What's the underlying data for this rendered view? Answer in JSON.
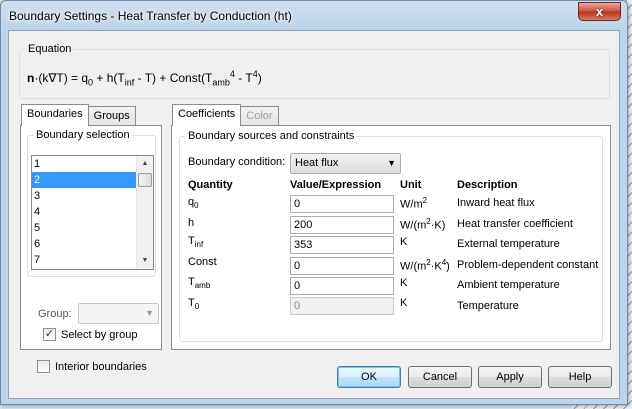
{
  "window": {
    "title": "Boundary Settings - Heat Transfer by Conduction (ht)",
    "close_glyph": "x"
  },
  "equation": {
    "label": "Equation",
    "n": "n",
    "p1": "·(k∇T) = q",
    "s1": "0",
    "p2": " + h(T",
    "s2": "inf",
    "p3": " - T) + Const(T",
    "s3": "amb",
    "s4": "4",
    "p4": " - T",
    "s5": "4",
    "p5": ")"
  },
  "left_tabs": [
    {
      "label": "Boundaries"
    },
    {
      "label": "Groups"
    }
  ],
  "boundary_selection": {
    "label": "Boundary selection",
    "items": [
      "1",
      "2",
      "3",
      "4",
      "5",
      "6",
      "7"
    ],
    "selected": "2"
  },
  "group": {
    "label": "Group:",
    "value": ""
  },
  "select_by_group": {
    "label": "Select by group",
    "checked": true,
    "mark": "✓"
  },
  "interior_boundaries": {
    "label": "Interior boundaries",
    "checked": false
  },
  "right_tabs": [
    {
      "label": "Coefficients"
    },
    {
      "label": "Color"
    }
  ],
  "sources": {
    "label": "Boundary sources and constraints",
    "condition_label": "Boundary condition:",
    "condition_value": "Heat flux",
    "headers": {
      "quantity": "Quantity",
      "value": "Value/Expression",
      "unit": "Unit",
      "description": "Description"
    },
    "rows": [
      {
        "q_main": "q",
        "q_sub": "0",
        "value": "0",
        "u_main": "W/m",
        "u_sup": "2",
        "u_end": "",
        "description": "Inward heat flux"
      },
      {
        "q_main": "h",
        "q_sub": "",
        "value": "200",
        "u_main": "W/(m",
        "u_sup": "2",
        "u_end": "·K)",
        "description": "Heat transfer coefficient"
      },
      {
        "q_main": "T",
        "q_sub": "inf",
        "value": "353",
        "u_main": "K",
        "u_sup": "",
        "u_end": "",
        "description": "External temperature"
      },
      {
        "q_main": "Const",
        "q_sub": "",
        "value": "0",
        "u_main": "W/(m",
        "u_sup": "2",
        "u_end": "·K",
        "u_sup2": "4",
        "u_end2": ")",
        "description": "Problem-dependent constant"
      },
      {
        "q_main": "T",
        "q_sub": "amb",
        "value": "0",
        "u_main": "K",
        "u_sup": "",
        "u_end": "",
        "description": "Ambient temperature"
      },
      {
        "q_main": "T",
        "q_sub": "0",
        "value": "0",
        "u_main": "K",
        "u_sup": "",
        "u_end": "",
        "description": "Temperature"
      }
    ]
  },
  "buttons": {
    "ok": "OK",
    "cancel": "Cancel",
    "apply": "Apply",
    "help": "Help"
  }
}
